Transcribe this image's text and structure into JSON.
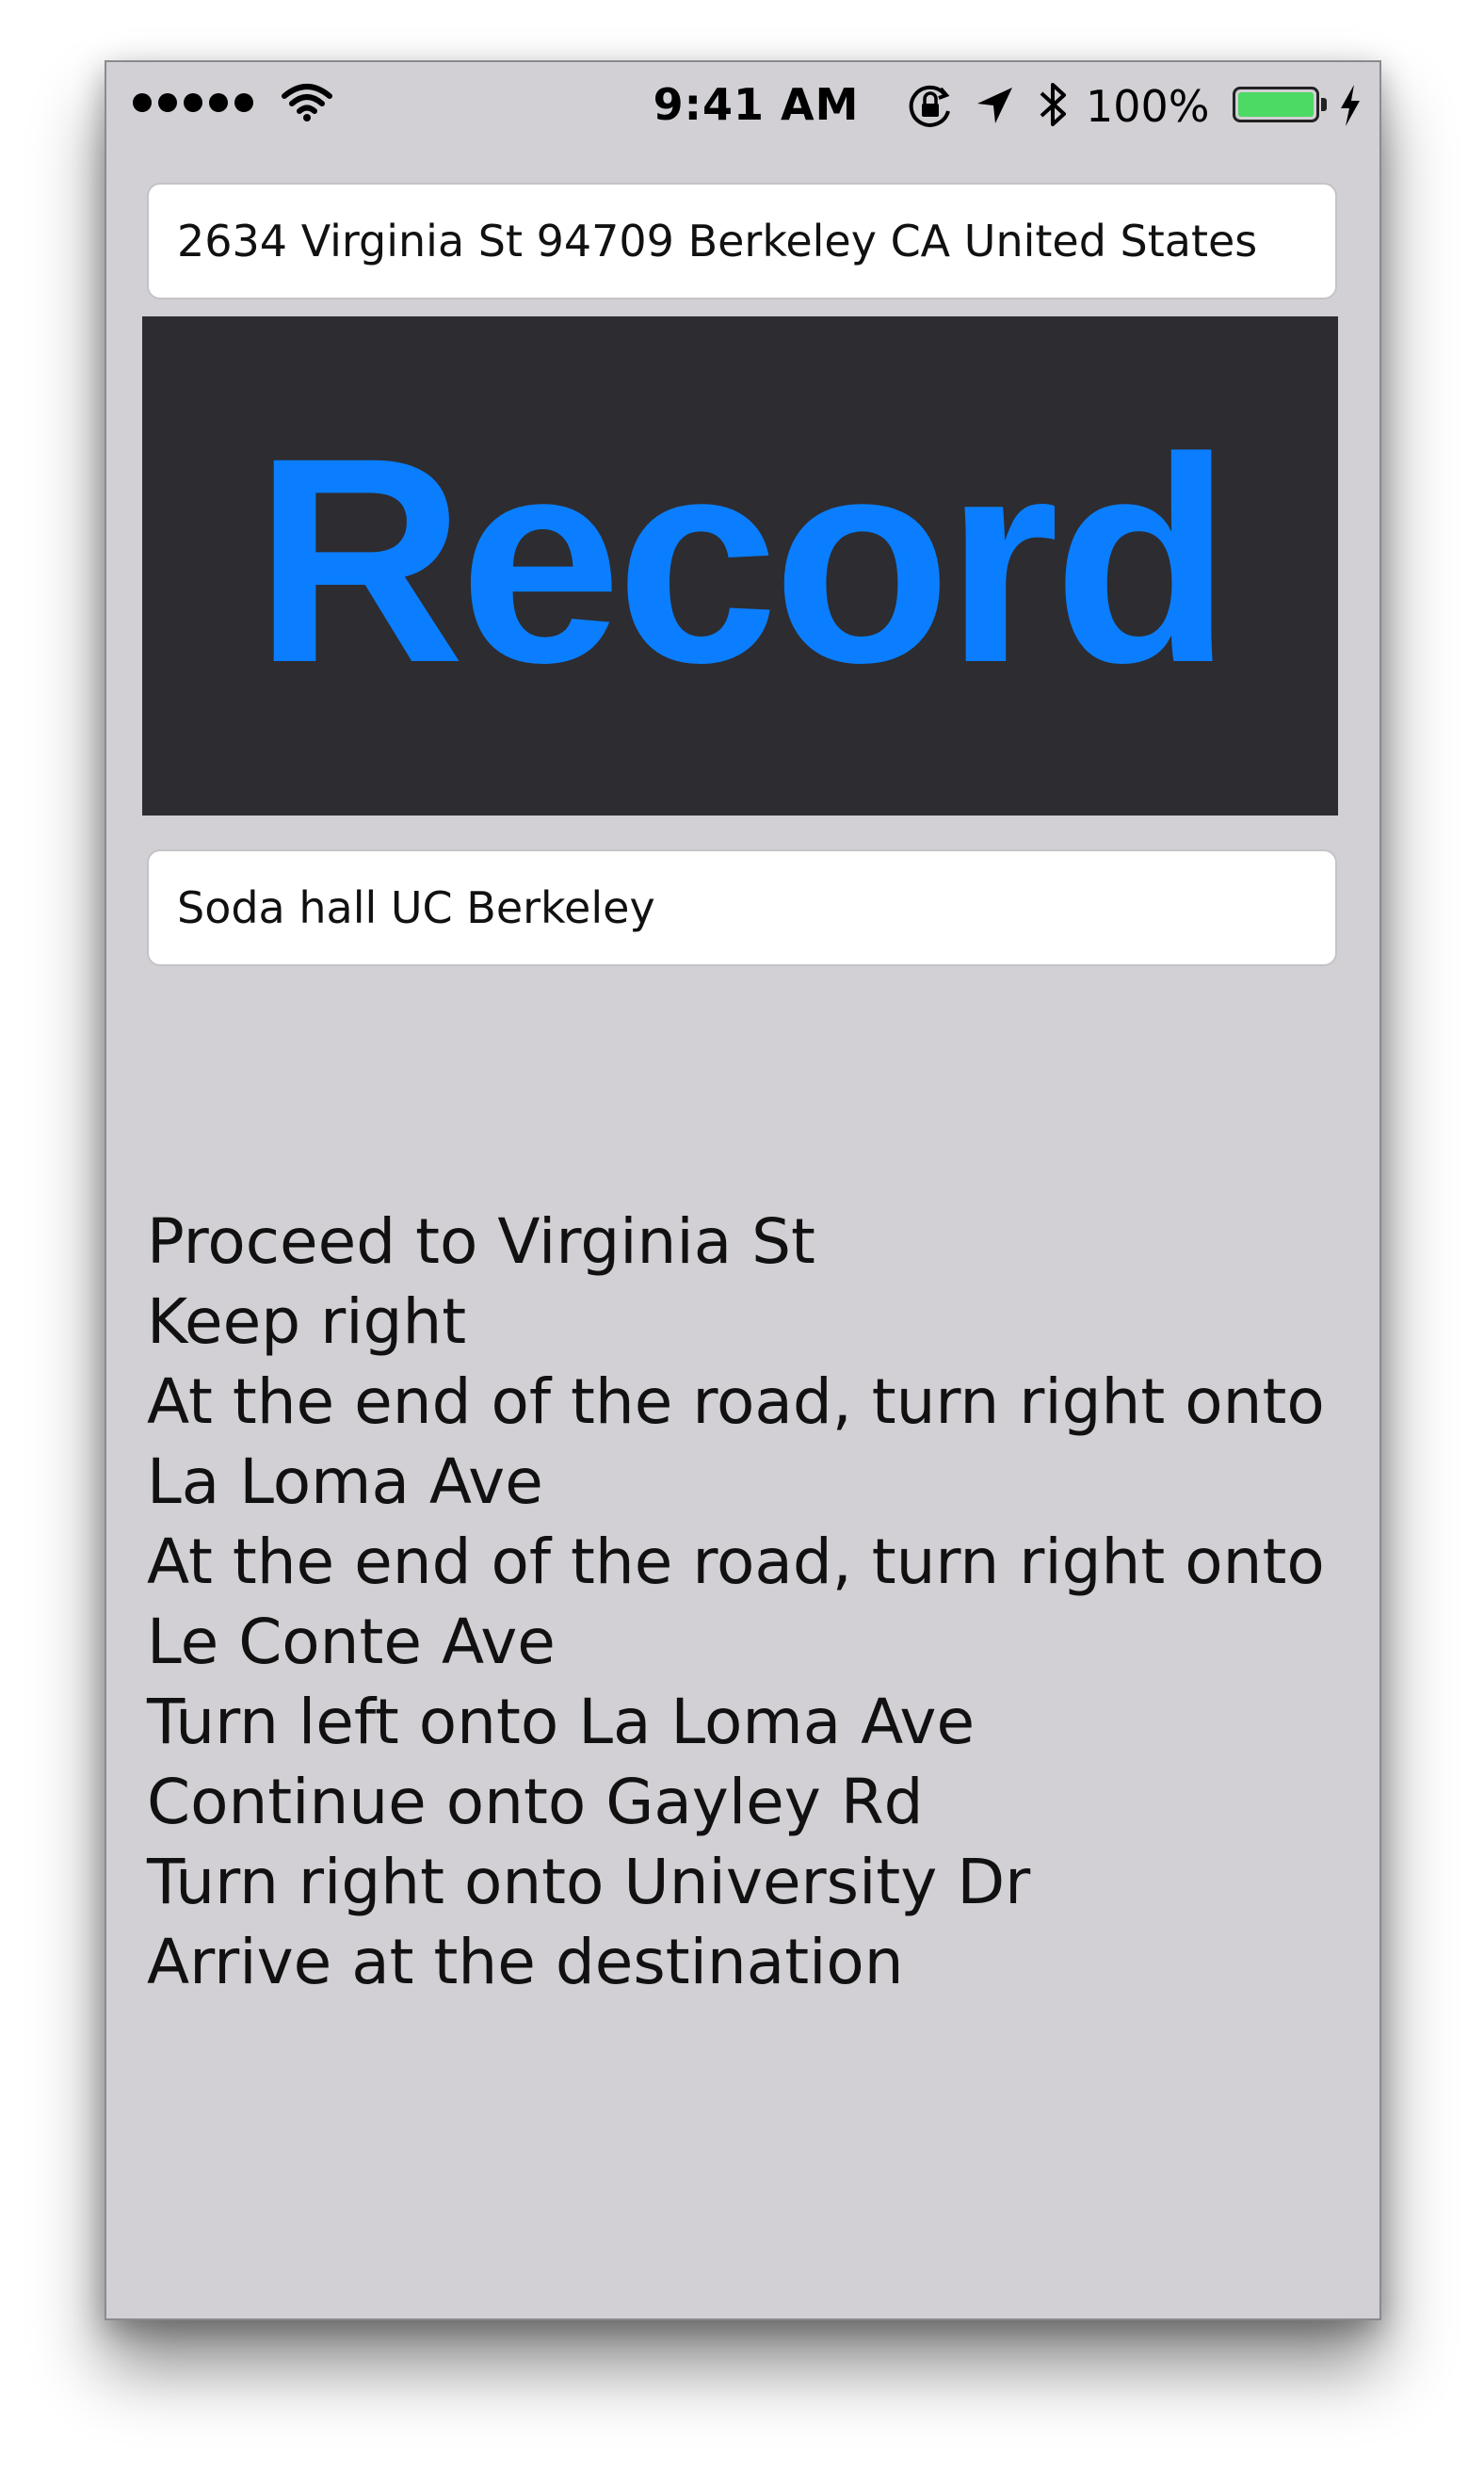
{
  "status_bar": {
    "signal_dots": 5,
    "time": "9:41 AM",
    "battery_percent_text": "100%",
    "battery_level": 1.0,
    "icons": [
      "signal-dots-icon",
      "wifi-icon",
      "orientation-lock-icon",
      "location-arrow-icon",
      "bluetooth-icon",
      "battery-icon",
      "charging-bolt-icon"
    ]
  },
  "origin_field": {
    "value": "2634 Virginia St 94709 Berkeley CA United States"
  },
  "record_button": {
    "label": "Record"
  },
  "destination_field": {
    "value": "Soda hall UC Berkeley"
  },
  "directions": [
    "Proceed to Virginia St",
    "Keep right",
    "At the end of the road, turn right onto",
    "La Loma Ave",
    "At the end of the road, turn right onto",
    "Le Conte Ave",
    "Turn left onto La Loma Ave",
    "Continue onto Gayley Rd",
    "Turn right onto University Dr",
    "Arrive at the destination"
  ],
  "colors": {
    "background": "#d2d0d4",
    "record_bg": "#2d2c30",
    "record_text": "#0a7eff",
    "battery_fill": "#4cd964"
  }
}
